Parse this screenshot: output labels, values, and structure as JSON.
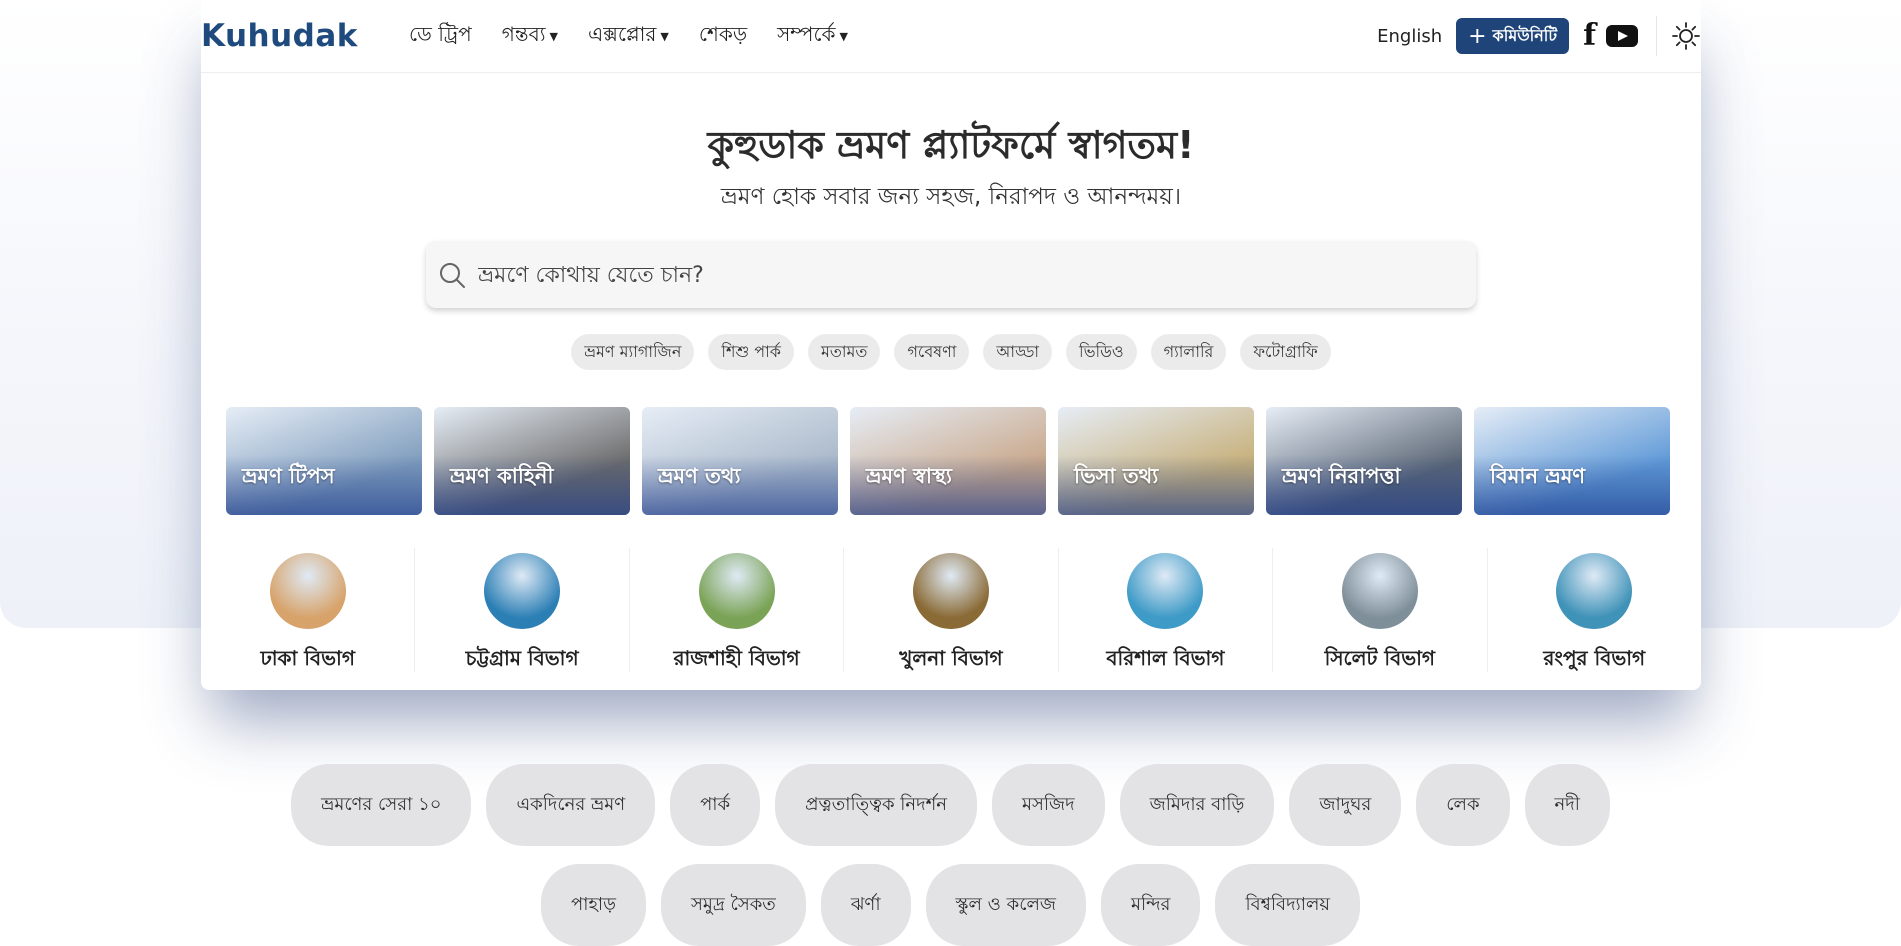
{
  "header": {
    "logo_text": "Kuhudak",
    "nav": [
      {
        "label": "ডে ট্রিপ",
        "has_dropdown": false
      },
      {
        "label": "গন্তব্য",
        "has_dropdown": true
      },
      {
        "label": "এক্সপ্লোর",
        "has_dropdown": true
      },
      {
        "label": "শেকড়",
        "has_dropdown": false
      },
      {
        "label": "সম্পর্কে",
        "has_dropdown": true
      }
    ],
    "language": "English",
    "community_button": "কমিউনিটি",
    "icons": [
      "facebook-icon",
      "youtube-icon",
      "sun-icon"
    ]
  },
  "hero": {
    "title": "কুহুডাক ভ্রমণ প্ল্যাটফর্মে স্বাগতম!",
    "subtitle": "ভ্রমণ হোক সবার জন্য সহজ, নিরাপদ ও আনন্দময়।",
    "search_placeholder": "ভ্রমণে কোথায় যেতে চান?"
  },
  "quick_links": [
    "ভ্রমণ ম্যাগাজিন",
    "শিশু পার্ক",
    "মতামত",
    "গবেষণা",
    "আড্ডা",
    "ভিডিও",
    "গ্যালারি",
    "ফটোগ্রাফি"
  ],
  "categories": [
    {
      "label": "ভ্রমণ টিপস",
      "color": "#7f9dbd"
    },
    {
      "label": "ভ্রমণ কাহিনী",
      "color": "#6b6b6b"
    },
    {
      "label": "ভ্রমণ তথ্য",
      "color": "#a9b8c9"
    },
    {
      "label": "ভ্রমণ স্বাস্থ্য",
      "color": "#c9a88b"
    },
    {
      "label": "ভিসা তথ্য",
      "color": "#c7b07a"
    },
    {
      "label": "ভ্রমণ নিরাপত্তা",
      "color": "#5b6675"
    },
    {
      "label": "বিমান ভ্রমণ",
      "color": "#5f9ad8"
    }
  ],
  "divisions": [
    {
      "label": "ঢাকা বিভাগ",
      "color": "#d7a36b"
    },
    {
      "label": "চট্টগ্রাম বিভাগ",
      "color": "#2c7fb5"
    },
    {
      "label": "রাজশাহী বিভাগ",
      "color": "#7aa356"
    },
    {
      "label": "খুলনা বিভাগ",
      "color": "#8a6a35"
    },
    {
      "label": "বরিশাল বিভাগ",
      "color": "#3e9ac7"
    },
    {
      "label": "সিলেট বিভাগ",
      "color": "#7f8f99"
    },
    {
      "label": "রংপুর বিভাগ",
      "color": "#3f92b8"
    }
  ],
  "tags_row1": [
    "ভ্রমণের সেরা ১০",
    "একদিনের ভ্রমণ",
    "পার্ক",
    "প্রত্নতাত্ত্বিক নিদর্শন",
    "মসজিদ",
    "জমিদার বাড়ি",
    "জাদুঘর",
    "লেক",
    "নদী"
  ],
  "tags_row2": [
    "পাহাড়",
    "সমুদ্র সৈকত",
    "ঝর্ণা",
    "স্কুল ও কলেজ",
    "মন্দির",
    "বিশ্ববিদ্যালয়"
  ]
}
